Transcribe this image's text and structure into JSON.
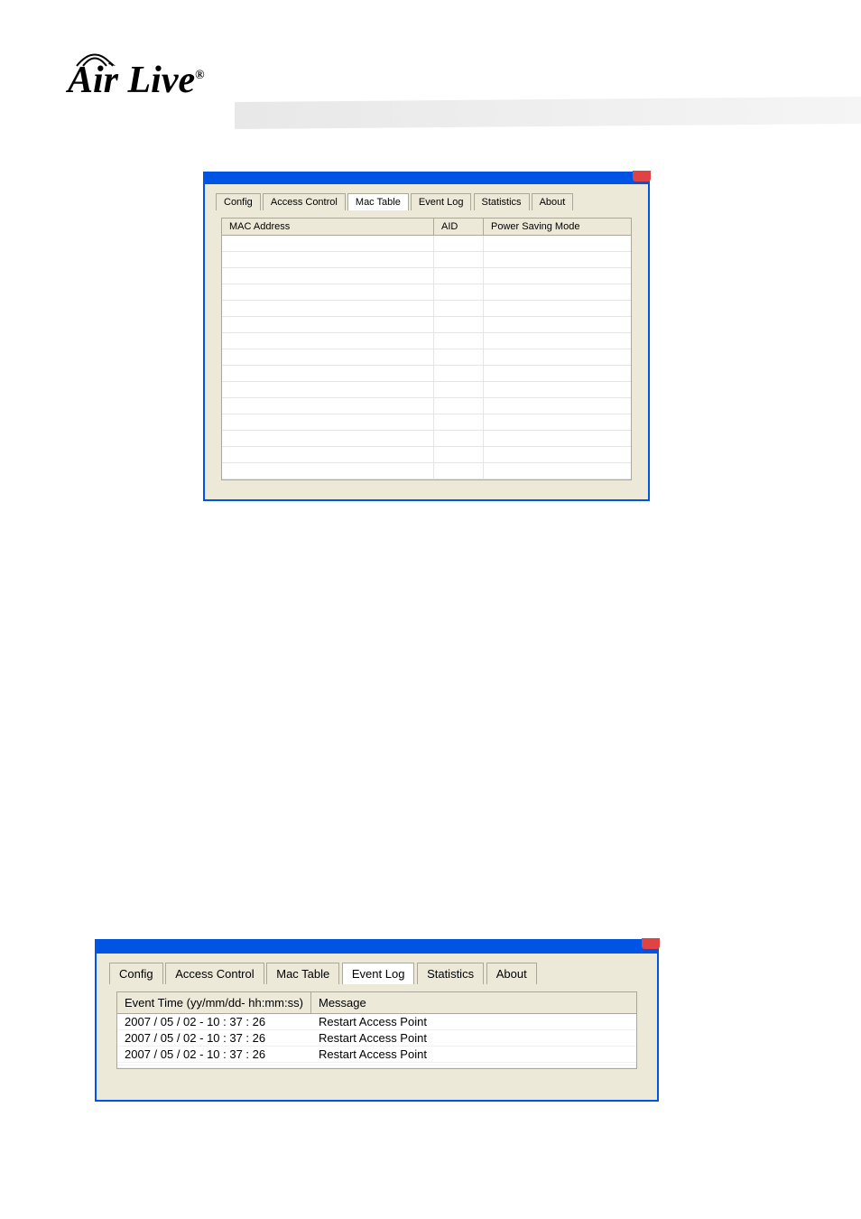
{
  "logo": {
    "text": "Air Live",
    "trademark": "®"
  },
  "window1": {
    "tabs": [
      {
        "label": "Config",
        "active": false
      },
      {
        "label": "Access Control",
        "active": false
      },
      {
        "label": "Mac Table",
        "active": true
      },
      {
        "label": "Event Log",
        "active": false
      },
      {
        "label": "Statistics",
        "active": false
      },
      {
        "label": "About",
        "active": false
      }
    ],
    "table": {
      "headers": {
        "mac": "MAC Address",
        "aid": "AID",
        "psm": "Power Saving Mode"
      },
      "rows": []
    }
  },
  "window2": {
    "tabs": [
      {
        "label": "Config",
        "active": false
      },
      {
        "label": "Access Control",
        "active": false
      },
      {
        "label": "Mac Table",
        "active": false
      },
      {
        "label": "Event Log",
        "active": true
      },
      {
        "label": "Statistics",
        "active": false
      },
      {
        "label": "About",
        "active": false
      }
    ],
    "table": {
      "headers": {
        "time": "Event Time (yy/mm/dd- hh:mm:ss)",
        "message": "Message"
      },
      "rows": [
        {
          "time": "2007 / 05 / 02 - 10 : 37 : 26",
          "message": "Restart Access Point"
        },
        {
          "time": "2007 / 05 / 02 - 10 : 37 : 26",
          "message": "Restart Access Point"
        },
        {
          "time": "2007 / 05 / 02 - 10 : 37 : 26",
          "message": "Restart Access Point"
        }
      ]
    }
  }
}
